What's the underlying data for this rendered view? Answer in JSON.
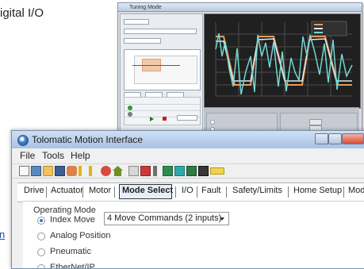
{
  "page_text": {
    "top_label": "igital I/O",
    "side_link": "n"
  },
  "tuning_window": {
    "title": "Tuning Mode"
  },
  "front_window": {
    "title": "Tolomatic Motion Interface",
    "menu": [
      "File",
      "Tools",
      "Help"
    ],
    "tabs": [
      "Drive",
      "Actuator",
      "Motor",
      "Mode Select",
      "I/O",
      "Fault",
      "Safety/Limits",
      "Home Setup",
      "Mode Setup"
    ],
    "active_tab": "Mode Select",
    "content": {
      "section_label": "Operating Mode",
      "options": [
        {
          "label": "Index Move",
          "selected": true
        },
        {
          "label": "Analog Position",
          "selected": false
        },
        {
          "label": "Pneumatic",
          "selected": false
        },
        {
          "label": "EtherNet/IP",
          "selected": false
        }
      ],
      "dropdown_value": "4 Move Commands (2 inputs)"
    }
  },
  "colors": {
    "accent": "#4176c5",
    "chart_background": "#202020",
    "chart_line_1": "#e89a54",
    "chart_line_2": "#dfe8f2",
    "chart_line_3": "#73d6d0"
  },
  "icons": {
    "toolbar": [
      "new-file-icon",
      "monitor-icon",
      "folder-icon",
      "save-icon",
      "brush-icon",
      "lightning-icon",
      "lightning-icon",
      "stop-icon",
      "home-icon",
      "magnet-icon",
      "waveform-icon",
      "toggle-icon",
      "chart-icon",
      "green-tool-icon",
      "gauge-icon",
      "flag-icon"
    ]
  }
}
